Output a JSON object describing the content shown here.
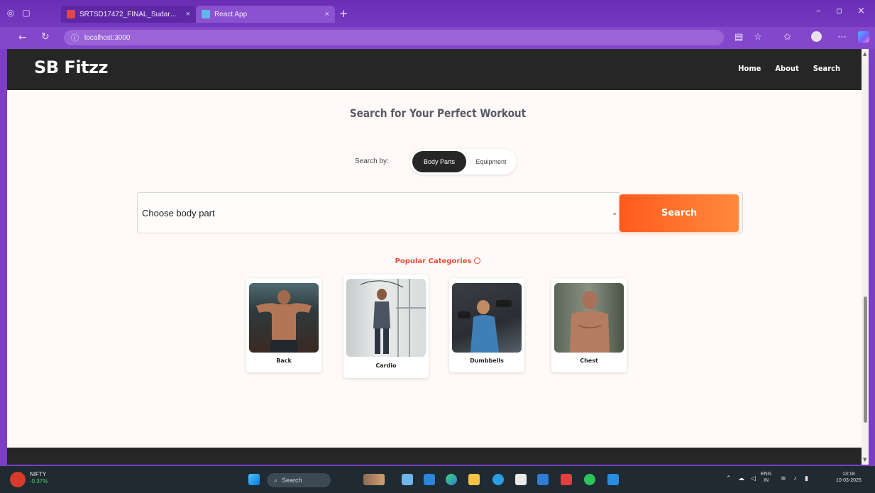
{
  "browser": {
    "tabs": [
      {
        "title": "SRTSD17472_FINAL_Sudarshan_...",
        "active": false
      },
      {
        "title": "React App",
        "active": true
      }
    ],
    "url": "localhost:3000"
  },
  "app": {
    "brand": "SB Fitzz",
    "nav": [
      "Home",
      "About",
      "Search"
    ],
    "heading": "Search for Your Perfect Workout",
    "search_by_label": "Search by:",
    "toggle_options": [
      {
        "label": "Body Parts",
        "active": true
      },
      {
        "label": "Equipment",
        "active": false
      }
    ],
    "select_value": "Choose body part",
    "search_button": "Search",
    "popular_heading": "Popular Categories",
    "categories": [
      {
        "label": "Back"
      },
      {
        "label": "Cardio"
      },
      {
        "label": "Dumbbells"
      },
      {
        "label": "Chest"
      }
    ]
  },
  "taskbar": {
    "ticker_name": "NIFTY",
    "ticker_change": "-0.37%",
    "search_placeholder": "Search",
    "lang": "ENG",
    "lang_region": "IN",
    "time": "13:18",
    "date": "10-03-2025"
  },
  "colors": {
    "browser_frame": "#7b3fc4",
    "navbar": "#262626",
    "accent_orange": "#ff6a2a",
    "popular_red": "#f04a3a"
  }
}
